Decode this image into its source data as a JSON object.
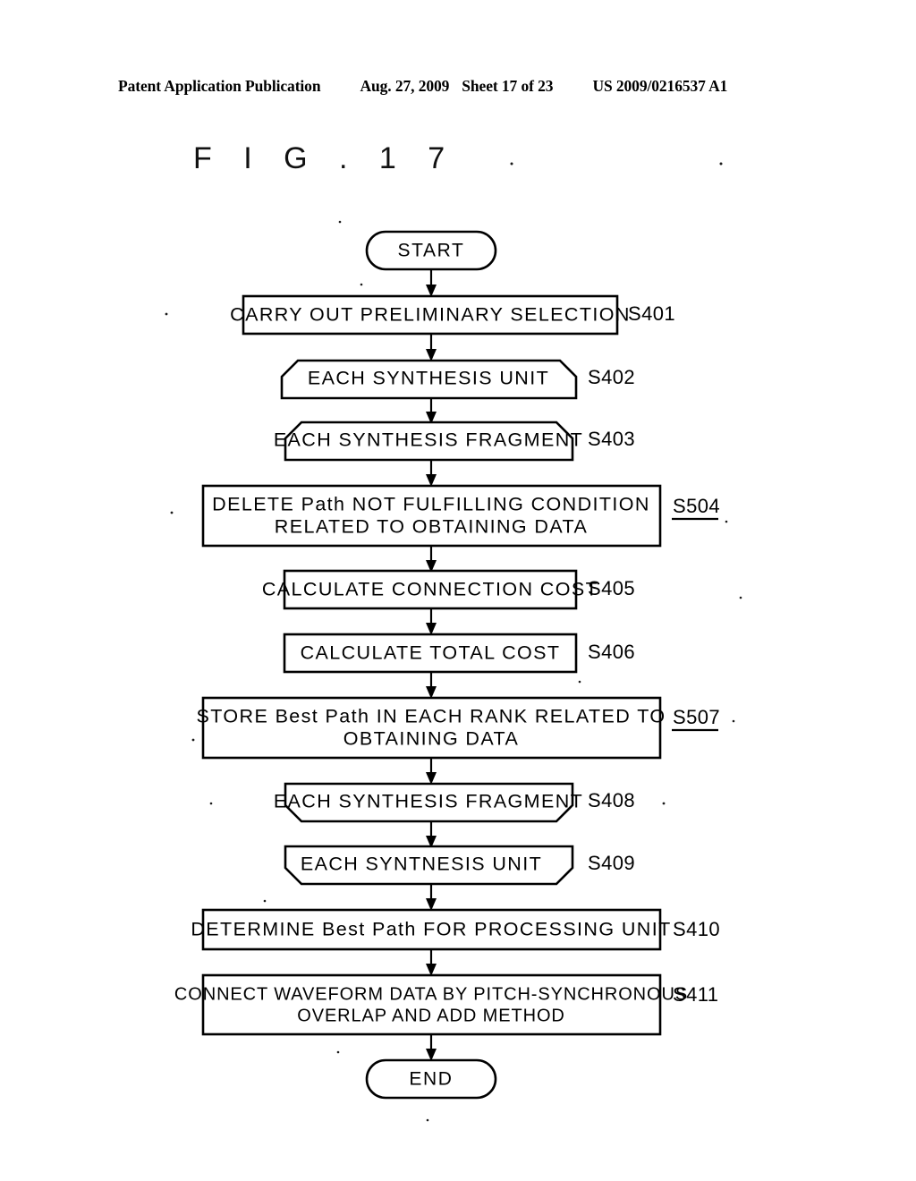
{
  "header": {
    "publication": "Patent Application Publication",
    "date": "Aug. 27, 2009",
    "sheet": "Sheet 17 of 23",
    "patent_number": "US 2009/0216537 A1"
  },
  "figure": {
    "title": "F I G .   1 7"
  },
  "flowchart": {
    "type": "flowchart",
    "orientation": "top-to-bottom",
    "nodes": [
      {
        "id": "start",
        "shape": "terminator",
        "label": "START",
        "tag": "",
        "tag_underlined": false
      },
      {
        "id": "s401",
        "shape": "process",
        "label": "CARRY OUT PRELIMINARY SELECTION",
        "tag": "S401",
        "tag_underlined": false
      },
      {
        "id": "s402",
        "shape": "loop-start",
        "label": "EACH SYNTHESIS UNIT",
        "tag": "S402",
        "tag_underlined": false
      },
      {
        "id": "s403",
        "shape": "loop-start",
        "label": "EACH SYNTHESIS FRAGMENT",
        "tag": "S403",
        "tag_underlined": false
      },
      {
        "id": "s504",
        "shape": "process",
        "label_line1": "DELETE Path NOT FULFILLING CONDITION",
        "label_line2": "RELATED TO OBTAINING DATA",
        "tag": "S504",
        "tag_underlined": true
      },
      {
        "id": "s405",
        "shape": "process",
        "label": "CALCULATE CONNECTION COST",
        "tag": "S405",
        "tag_underlined": false
      },
      {
        "id": "s406",
        "shape": "process",
        "label": "CALCULATE TOTAL COST",
        "tag": "S406",
        "tag_underlined": false
      },
      {
        "id": "s507",
        "shape": "process",
        "label_line1": "STORE Best Path IN EACH RANK RELATED TO",
        "label_line2": "OBTAINING DATA",
        "tag": "S507",
        "tag_underlined": true
      },
      {
        "id": "s408",
        "shape": "loop-end",
        "label": "EACH SYNTHESIS FRAGMENT",
        "tag": "S408",
        "tag_underlined": false
      },
      {
        "id": "s409",
        "shape": "loop-end",
        "label": "EACH SYNTNESIS UNIT",
        "tag": "S409",
        "tag_underlined": false
      },
      {
        "id": "s410",
        "shape": "process",
        "label": "DETERMINE Best Path FOR PROCESSING UNIT",
        "tag": "S410",
        "tag_underlined": false
      },
      {
        "id": "s411",
        "shape": "process",
        "label_line1": "CONNECT WAVEFORM DATA BY PITCH-SYNCHRONOUS",
        "label_line2": "OVERLAP AND ADD METHOD",
        "tag": "S411",
        "tag_underlined": false
      },
      {
        "id": "end",
        "shape": "terminator",
        "label": "END",
        "tag": "",
        "tag_underlined": false
      }
    ],
    "edges": [
      {
        "from": "start",
        "to": "s401"
      },
      {
        "from": "s401",
        "to": "s402"
      },
      {
        "from": "s402",
        "to": "s403"
      },
      {
        "from": "s403",
        "to": "s504"
      },
      {
        "from": "s504",
        "to": "s405"
      },
      {
        "from": "s405",
        "to": "s406"
      },
      {
        "from": "s406",
        "to": "s507"
      },
      {
        "from": "s507",
        "to": "s408"
      },
      {
        "from": "s408",
        "to": "s409"
      },
      {
        "from": "s409",
        "to": "s410"
      },
      {
        "from": "s410",
        "to": "s411"
      },
      {
        "from": "s411",
        "to": "end"
      }
    ]
  },
  "colors": {
    "ink": "#000000",
    "paper": "#ffffff"
  }
}
